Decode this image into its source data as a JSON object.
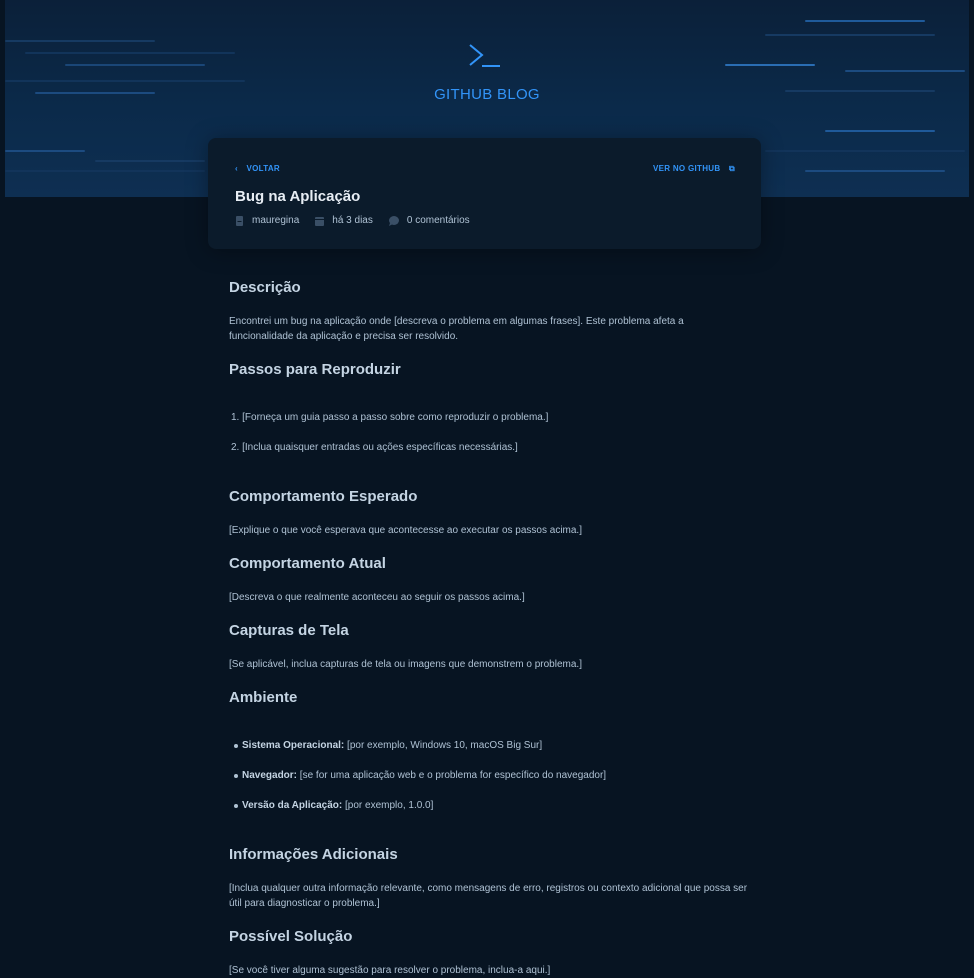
{
  "brand": {
    "title": "GITHUB BLOG"
  },
  "post": {
    "back_label": "VOLTAR",
    "github_label": "VER NO GITHUB",
    "title": "Bug na Aplicação",
    "author": "mauregina",
    "time": "há 3 dias",
    "comments": "0 comentários"
  },
  "body": {
    "descricao": {
      "heading": "Descrição",
      "text": "Encontrei um bug na aplicação onde [descreva o problema em algumas frases]. Este problema afeta a funcionalidade da aplicação e precisa ser resolvido."
    },
    "passos": {
      "heading": "Passos para Reproduzir",
      "items": [
        "1. [Forneça um guia passo a passo sobre como reproduzir o problema.]",
        "2. [Inclua quaisquer entradas ou ações específicas necessárias.]"
      ]
    },
    "esperado": {
      "heading": "Comportamento Esperado",
      "text": "[Explique o que você esperava que acontecesse ao executar os passos acima.]"
    },
    "atual": {
      "heading": "Comportamento Atual",
      "text": "[Descreva o que realmente aconteceu ao seguir os passos acima.]"
    },
    "capturas": {
      "heading": "Capturas de Tela",
      "text": "[Se aplicável, inclua capturas de tela ou imagens que demonstrem o problema.]"
    },
    "ambiente": {
      "heading": "Ambiente",
      "items": [
        {
          "label": "Sistema Operacional:",
          "value": " [por exemplo, Windows 10, macOS Big Sur]"
        },
        {
          "label": "Navegador:",
          "value": " [se for uma aplicação web e o problema for específico do navegador]"
        },
        {
          "label": "Versão da Aplicação:",
          "value": " [por exemplo, 1.0.0]"
        }
      ]
    },
    "adicionais": {
      "heading": "Informações Adicionais",
      "text": "[Inclua qualquer outra informação relevante, como mensagens de erro, registros ou contexto adicional que possa ser útil para diagnosticar o problema.]"
    },
    "solucao": {
      "heading": "Possível Solução",
      "text": "[Se você tiver alguma sugestão para resolver o problema, inclua-a aqui.]"
    }
  },
  "colors": {
    "accent": "#3294f8",
    "background": "#071422",
    "card": "#0b1b2b",
    "title": "#e7edf4",
    "text": "#afc2d4"
  },
  "icons": [
    "terminal-icon",
    "chevron-left-icon",
    "external-link-icon",
    "user-icon",
    "calendar-icon",
    "comment-icon"
  ]
}
